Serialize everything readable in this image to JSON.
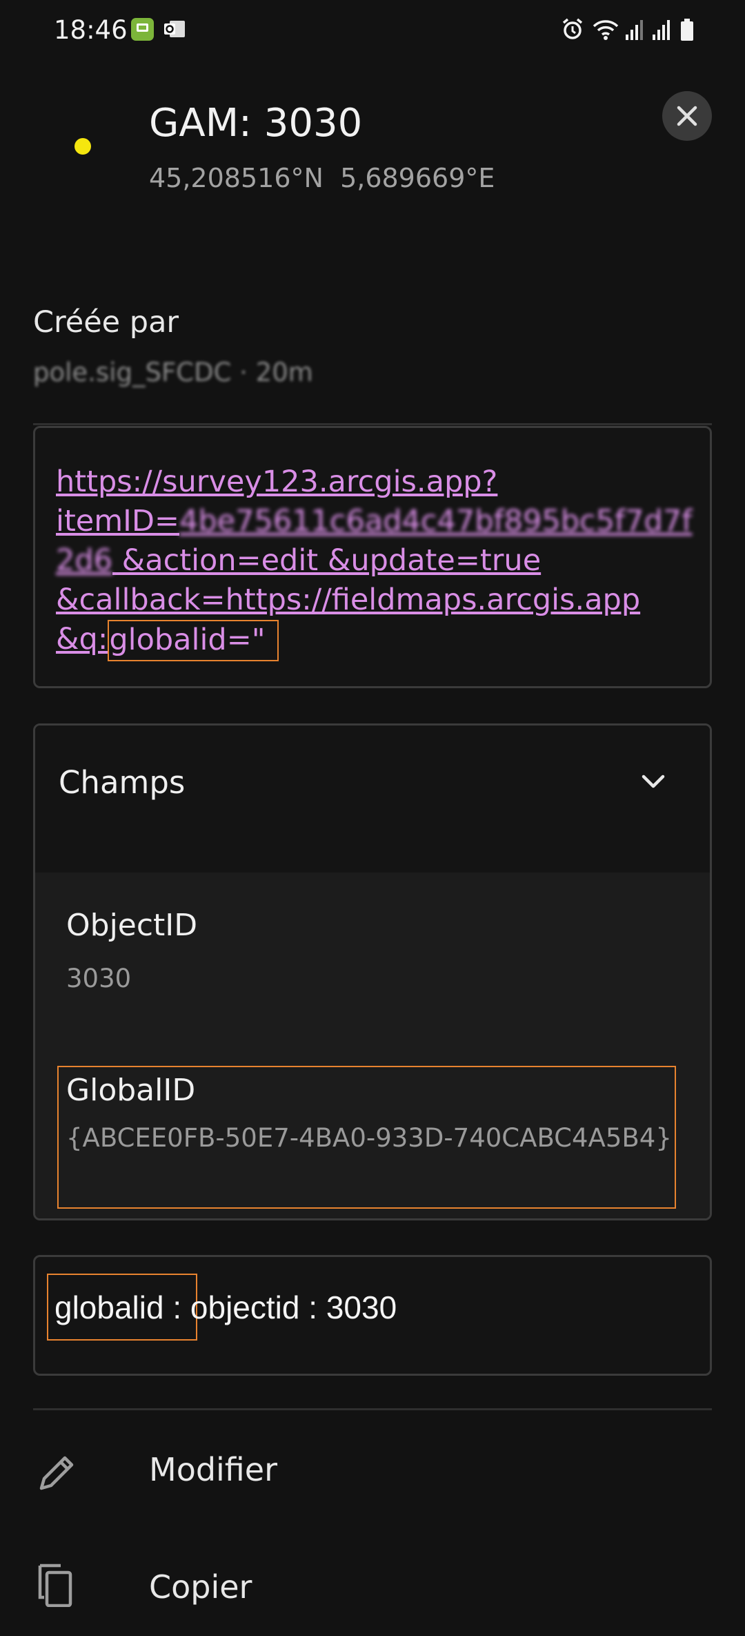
{
  "status_bar": {
    "time": "18:46",
    "icons": [
      "messages-notification-icon",
      "outlook-notification-icon",
      "alarm-icon",
      "wifi-icon",
      "signal-icon",
      "signal-icon",
      "battery-icon"
    ]
  },
  "header": {
    "title": "GAM: 3030",
    "coordinates": "45,208516°N  5,689669°E",
    "marker_color": "#f5e60f"
  },
  "created": {
    "label": "Créée par",
    "value": "pole.sig_SFCDC · 20m"
  },
  "url": {
    "line1": "https://survey123.arcgis.app?",
    "line2_prefix": "itemID=",
    "item_id": "4be75611c6ad4c47bf895bc5f7d7f2d6",
    "line3": " &action=edit &update=true",
    "line4": "&callback=https://fieldmaps.arcgis.app",
    "line5_prefix": "&q:",
    "line5_highlight": "globalid=\""
  },
  "fields": {
    "section_label": "Champs",
    "items": [
      {
        "label": "ObjectID",
        "value": "3030"
      },
      {
        "label": "GlobalID",
        "value": "{ABCEE0FB-50E7-4BA0-933D-740CABC4A5B4}"
      }
    ]
  },
  "summary": {
    "globalid_label": "globalid :",
    "objectid_text": "objectid : 3030"
  },
  "actions": [
    {
      "label": "Modifier",
      "icon": "pencil-icon"
    },
    {
      "label": "Copier",
      "icon": "copy-icon"
    }
  ],
  "colors": {
    "background": "#121212",
    "link": "#d98ee6",
    "highlight_border": "#e8832f"
  }
}
